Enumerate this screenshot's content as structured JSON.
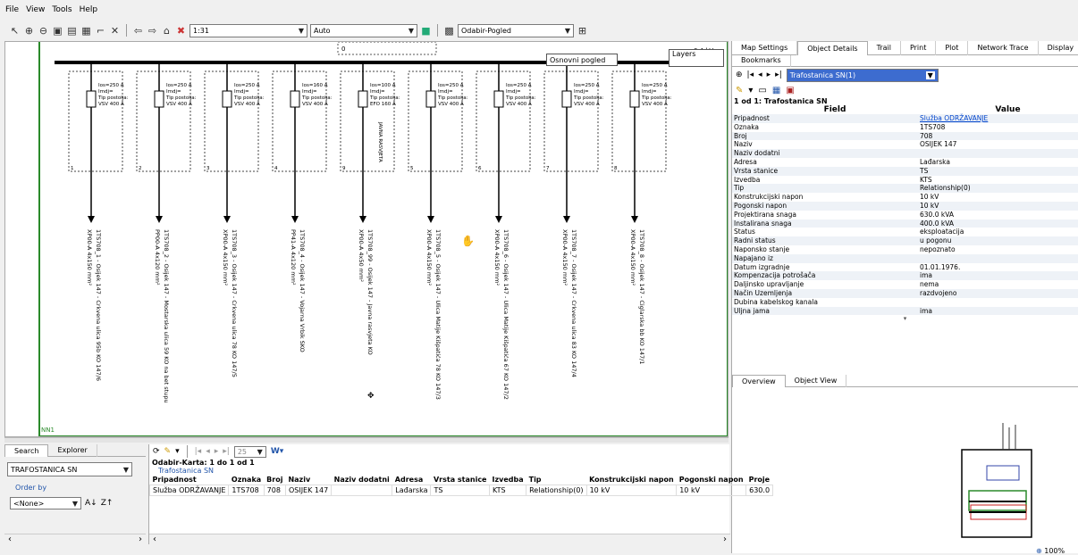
{
  "menu": [
    "File",
    "View",
    "Tools",
    "Help"
  ],
  "toolbar": {
    "scale_value": "1:31",
    "mode_value": "Auto",
    "view_value": "Odabir-Pogled"
  },
  "map": {
    "tooltip_label": "Osnovni pogled",
    "layers_label": "Layers",
    "busbar_label": "0",
    "voltage_label": "0.4 kV",
    "frame_label": "NN1",
    "feeders": [
      {
        "num": "1",
        "ios": "Ios=250 A",
        "imdj": "Imdj=",
        "tip": "Tip postolja:",
        "vsv": "VSV 400 A",
        "label": "1TS708_1 - Osijek 147 - Crkvena ulica 95b KO 147/6",
        "cable": "XP00-A 4x150 mm²"
      },
      {
        "num": "2",
        "ios": "Ios=250 A",
        "imdj": "Imdj=",
        "tip": "Tip postolja:",
        "vsv": "VSV 400 A",
        "label": "1TS708_2 - Osijek 147 - Mostarska ulica 59 KO na bet stupu",
        "cable": "PP00-A 4x120 mm²"
      },
      {
        "num": "3",
        "ios": "Ios=250 A",
        "imdj": "Imdj=",
        "tip": "Tip postolja:",
        "vsv": "VSV 400 A",
        "label": "1TS708_3 - Osijek 147 - Crkvena ulica 78 KO 147/5",
        "cable": "XP00-A 4x150 mm²"
      },
      {
        "num": "4",
        "ios": "Ios=160 A",
        "imdj": "Imdj=",
        "tip": "Tip postolja:",
        "vsv": "VSV 400 A",
        "label": "1TS708_4 - Osijek 147 - Vojarna Vrbik SKO",
        "cable": "PP41-A 4x120 mm²"
      },
      {
        "num": "9",
        "ios": "Ios=100 A",
        "imdj": "Imdj=",
        "tip": "Tip postolja:",
        "vsv": "EFO 160 A",
        "label": "1TS708_99 - Osijek 147 - Javna rasvjeta KO",
        "cable": "XP00-A 4x50 mm²"
      },
      {
        "num": "5",
        "ios": "Ios=250 A",
        "imdj": "Imdj=",
        "tip": "Tip postolja:",
        "vsv": "VSV 400 A",
        "label": "1TS708_5 - Osijek 147 - Ulica Matije Kišpatića 78 KO 147/3",
        "cable": "XP00-A 4x150 mm²"
      },
      {
        "num": "6",
        "ios": "Ios=250 A",
        "imdj": "Imdj=",
        "tip": "Tip postolja:",
        "vsv": "VSV 400 A",
        "label": "1TS708_6 - Osijek 147 - Ulica Matije Kišpatića 67 KO 147/2",
        "cable": "XP00-A 4x150 mm²"
      },
      {
        "num": "7",
        "ios": "Ios=250 A",
        "imdj": "Imdj=",
        "tip": "Tip postolja:",
        "vsv": "VSV 400 A",
        "label": "1TS708_7 - Osijek 147 - Crkvena ulica 83 KO 147/4",
        "cable": "XP00-A 4x150 mm²"
      },
      {
        "num": "8",
        "ios": "Ios=250 A",
        "imdj": "Imdj=",
        "tip": "Tip postolja:",
        "vsv": "VSV 400 A",
        "label": "1TS708_8 - Osijek 147 - Ciglarska bb KO 147/1",
        "cable": "XP00-A 4x150 mm²"
      }
    ],
    "rasvjeta_label": "JAVNA RASVJETA"
  },
  "right": {
    "tabs": [
      "Map Settings",
      "Object Details",
      "Trail",
      "Print",
      "Plot",
      "Network Trace",
      "Display"
    ],
    "tab2": "Bookmarks",
    "object_select": "Trafostanica SN(1)",
    "heading": "1 od 1: Trafostanica SN",
    "col_field": "Field",
    "col_value": "Value",
    "rows": [
      [
        "Pripadnost",
        "Služba ODRŽAVANJE"
      ],
      [
        "Oznaka",
        "1TS708"
      ],
      [
        "Broj",
        "708"
      ],
      [
        "Naziv",
        "OSIJEK 147"
      ],
      [
        "Naziv dodatni",
        ""
      ],
      [
        "Adresa",
        "Lađarska"
      ],
      [
        "Vrsta stanice",
        "TS"
      ],
      [
        "Izvedba",
        "KTS"
      ],
      [
        "Tip",
        "Relationship(0)"
      ],
      [
        "Konstrukcijski napon",
        "10 kV"
      ],
      [
        "Pogonski napon",
        "10 kV"
      ],
      [
        "Projektirana snaga",
        "630.0 kVA"
      ],
      [
        "Instalirana snaga",
        "400.0 kVA"
      ],
      [
        "Status",
        "eksploatacija"
      ],
      [
        "Radni status",
        "u pogonu"
      ],
      [
        "Naponsko stanje",
        "nepoznato"
      ],
      [
        "Napajano iz",
        ""
      ],
      [
        "Datum izgradnje",
        "01.01.1976."
      ],
      [
        "Kompenzacija potrošača",
        "ima"
      ],
      [
        "Daljinsko upravljanje",
        "nema"
      ],
      [
        "Način Uzemljenja",
        "razdvojeno"
      ],
      [
        "Dubina kabelskog kanala",
        ""
      ],
      [
        "Uljna jama",
        "ima"
      ]
    ],
    "bottom_tabs": [
      "Overview",
      "Object View"
    ],
    "zoom": "100%"
  },
  "left_panel": {
    "tabs": [
      "Search",
      "Explorer"
    ],
    "layer_select": "TRAFOSTANICA SN",
    "order_by": "Order by",
    "order_value": "<None>"
  },
  "results": {
    "page_select": "25",
    "heading": "Odabir-Karta: 1 do 1 od 1",
    "layer": "Trafostanica SN",
    "columns": [
      "Pripadnost",
      "Oznaka",
      "Broj",
      "Naziv",
      "Naziv dodatni",
      "Adresa",
      "Vrsta stanice",
      "Izvedba",
      "Tip",
      "Konstrukcijski napon",
      "Pogonski napon",
      "Proje"
    ],
    "row": [
      "Služba ODRŽAVANJE",
      "1TS708",
      "708",
      "OSIJEK 147",
      "",
      "Lađarska",
      "TS",
      "KTS",
      "Relationship(0)",
      "10 kV",
      "10 kV",
      "630.0"
    ]
  }
}
